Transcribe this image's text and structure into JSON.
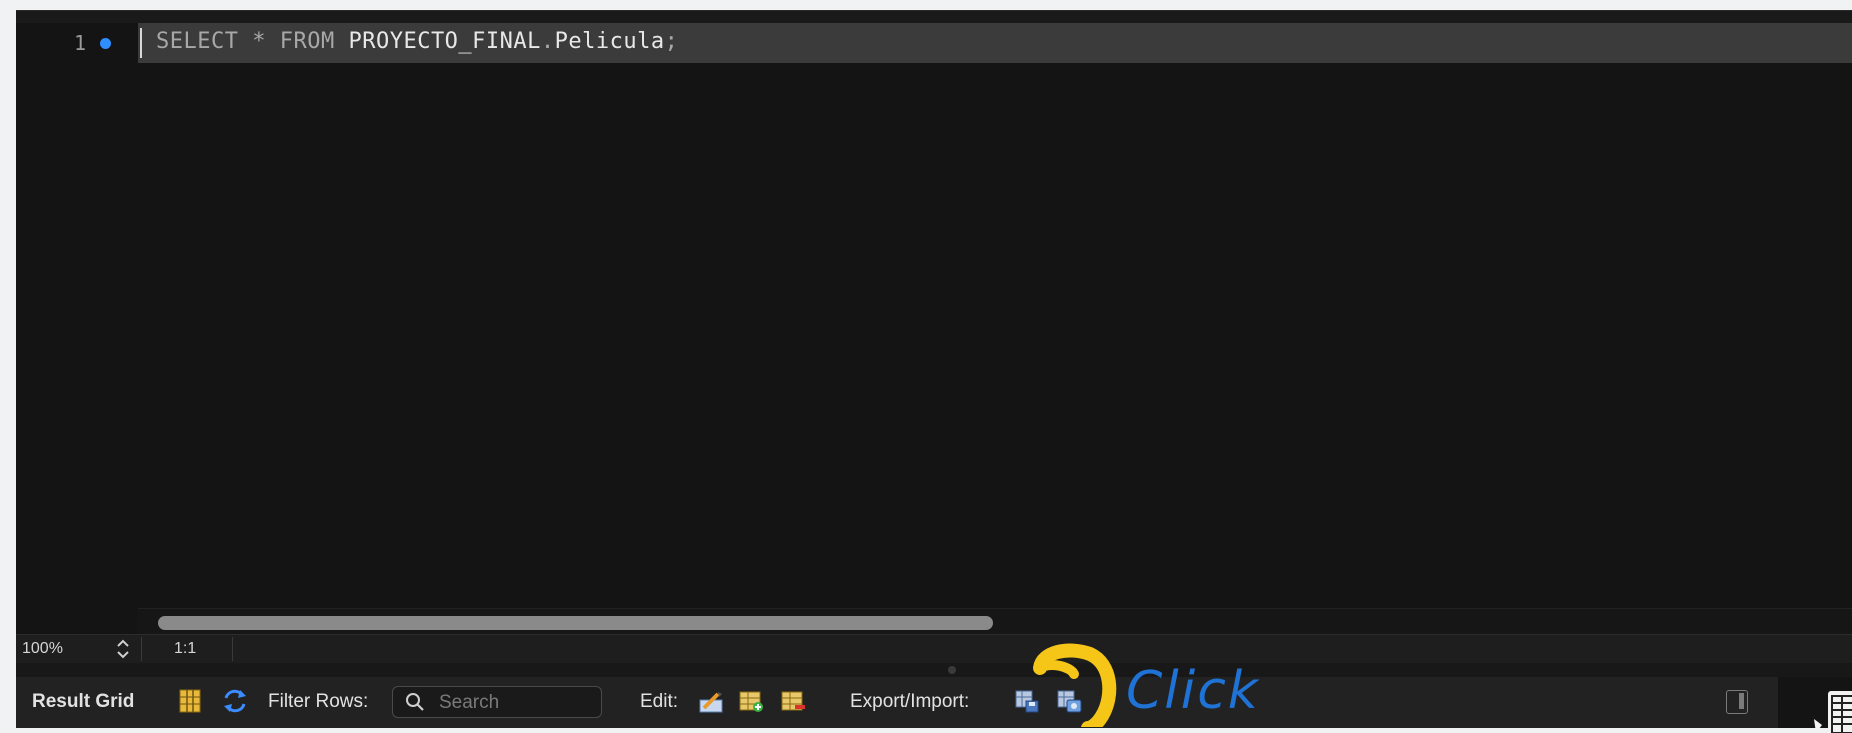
{
  "editor": {
    "line_number": "1",
    "code": {
      "kw1": "SELECT",
      "star": "*",
      "kw2": "FROM",
      "schema": "PROYECTO_FINAL",
      "dot": ".",
      "table": "Pelicula",
      "semicolon": ";"
    }
  },
  "status": {
    "zoom": "100%",
    "cursor_position": "1:1"
  },
  "toolbar": {
    "result_grid_label": "Result Grid",
    "filter_rows_label": "Filter Rows:",
    "search_placeholder": "Search",
    "edit_label": "Edit:",
    "export_import_label": "Export/Import:"
  },
  "annotation": {
    "text": "Click",
    "circle_color": "#f5c518",
    "text_color": "#1f73d6"
  },
  "colors": {
    "editor_bg": "#141414",
    "current_line": "#3b3b3b",
    "accent_blue": "#2f8fff"
  }
}
